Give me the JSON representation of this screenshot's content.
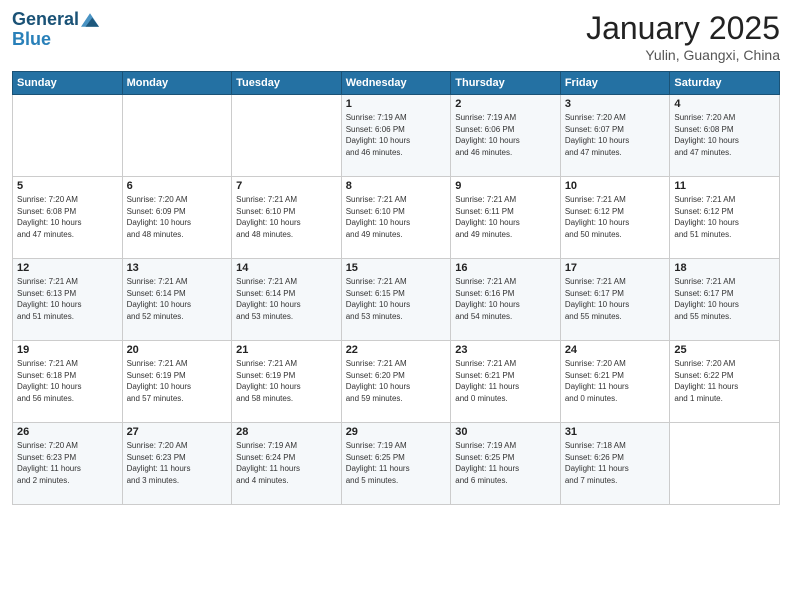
{
  "header": {
    "logo_line1": "General",
    "logo_line2": "Blue",
    "title": "January 2025",
    "location": "Yulin, Guangxi, China"
  },
  "days_of_week": [
    "Sunday",
    "Monday",
    "Tuesday",
    "Wednesday",
    "Thursday",
    "Friday",
    "Saturday"
  ],
  "weeks": [
    [
      {
        "day": "",
        "info": ""
      },
      {
        "day": "",
        "info": ""
      },
      {
        "day": "",
        "info": ""
      },
      {
        "day": "1",
        "info": "Sunrise: 7:19 AM\nSunset: 6:06 PM\nDaylight: 10 hours\nand 46 minutes."
      },
      {
        "day": "2",
        "info": "Sunrise: 7:19 AM\nSunset: 6:06 PM\nDaylight: 10 hours\nand 46 minutes."
      },
      {
        "day": "3",
        "info": "Sunrise: 7:20 AM\nSunset: 6:07 PM\nDaylight: 10 hours\nand 47 minutes."
      },
      {
        "day": "4",
        "info": "Sunrise: 7:20 AM\nSunset: 6:08 PM\nDaylight: 10 hours\nand 47 minutes."
      }
    ],
    [
      {
        "day": "5",
        "info": "Sunrise: 7:20 AM\nSunset: 6:08 PM\nDaylight: 10 hours\nand 47 minutes."
      },
      {
        "day": "6",
        "info": "Sunrise: 7:20 AM\nSunset: 6:09 PM\nDaylight: 10 hours\nand 48 minutes."
      },
      {
        "day": "7",
        "info": "Sunrise: 7:21 AM\nSunset: 6:10 PM\nDaylight: 10 hours\nand 48 minutes."
      },
      {
        "day": "8",
        "info": "Sunrise: 7:21 AM\nSunset: 6:10 PM\nDaylight: 10 hours\nand 49 minutes."
      },
      {
        "day": "9",
        "info": "Sunrise: 7:21 AM\nSunset: 6:11 PM\nDaylight: 10 hours\nand 49 minutes."
      },
      {
        "day": "10",
        "info": "Sunrise: 7:21 AM\nSunset: 6:12 PM\nDaylight: 10 hours\nand 50 minutes."
      },
      {
        "day": "11",
        "info": "Sunrise: 7:21 AM\nSunset: 6:12 PM\nDaylight: 10 hours\nand 51 minutes."
      }
    ],
    [
      {
        "day": "12",
        "info": "Sunrise: 7:21 AM\nSunset: 6:13 PM\nDaylight: 10 hours\nand 51 minutes."
      },
      {
        "day": "13",
        "info": "Sunrise: 7:21 AM\nSunset: 6:14 PM\nDaylight: 10 hours\nand 52 minutes."
      },
      {
        "day": "14",
        "info": "Sunrise: 7:21 AM\nSunset: 6:14 PM\nDaylight: 10 hours\nand 53 minutes."
      },
      {
        "day": "15",
        "info": "Sunrise: 7:21 AM\nSunset: 6:15 PM\nDaylight: 10 hours\nand 53 minutes."
      },
      {
        "day": "16",
        "info": "Sunrise: 7:21 AM\nSunset: 6:16 PM\nDaylight: 10 hours\nand 54 minutes."
      },
      {
        "day": "17",
        "info": "Sunrise: 7:21 AM\nSunset: 6:17 PM\nDaylight: 10 hours\nand 55 minutes."
      },
      {
        "day": "18",
        "info": "Sunrise: 7:21 AM\nSunset: 6:17 PM\nDaylight: 10 hours\nand 55 minutes."
      }
    ],
    [
      {
        "day": "19",
        "info": "Sunrise: 7:21 AM\nSunset: 6:18 PM\nDaylight: 10 hours\nand 56 minutes."
      },
      {
        "day": "20",
        "info": "Sunrise: 7:21 AM\nSunset: 6:19 PM\nDaylight: 10 hours\nand 57 minutes."
      },
      {
        "day": "21",
        "info": "Sunrise: 7:21 AM\nSunset: 6:19 PM\nDaylight: 10 hours\nand 58 minutes."
      },
      {
        "day": "22",
        "info": "Sunrise: 7:21 AM\nSunset: 6:20 PM\nDaylight: 10 hours\nand 59 minutes."
      },
      {
        "day": "23",
        "info": "Sunrise: 7:21 AM\nSunset: 6:21 PM\nDaylight: 11 hours\nand 0 minutes."
      },
      {
        "day": "24",
        "info": "Sunrise: 7:20 AM\nSunset: 6:21 PM\nDaylight: 11 hours\nand 0 minutes."
      },
      {
        "day": "25",
        "info": "Sunrise: 7:20 AM\nSunset: 6:22 PM\nDaylight: 11 hours\nand 1 minute."
      }
    ],
    [
      {
        "day": "26",
        "info": "Sunrise: 7:20 AM\nSunset: 6:23 PM\nDaylight: 11 hours\nand 2 minutes."
      },
      {
        "day": "27",
        "info": "Sunrise: 7:20 AM\nSunset: 6:23 PM\nDaylight: 11 hours\nand 3 minutes."
      },
      {
        "day": "28",
        "info": "Sunrise: 7:19 AM\nSunset: 6:24 PM\nDaylight: 11 hours\nand 4 minutes."
      },
      {
        "day": "29",
        "info": "Sunrise: 7:19 AM\nSunset: 6:25 PM\nDaylight: 11 hours\nand 5 minutes."
      },
      {
        "day": "30",
        "info": "Sunrise: 7:19 AM\nSunset: 6:25 PM\nDaylight: 11 hours\nand 6 minutes."
      },
      {
        "day": "31",
        "info": "Sunrise: 7:18 AM\nSunset: 6:26 PM\nDaylight: 11 hours\nand 7 minutes."
      },
      {
        "day": "",
        "info": ""
      }
    ]
  ]
}
